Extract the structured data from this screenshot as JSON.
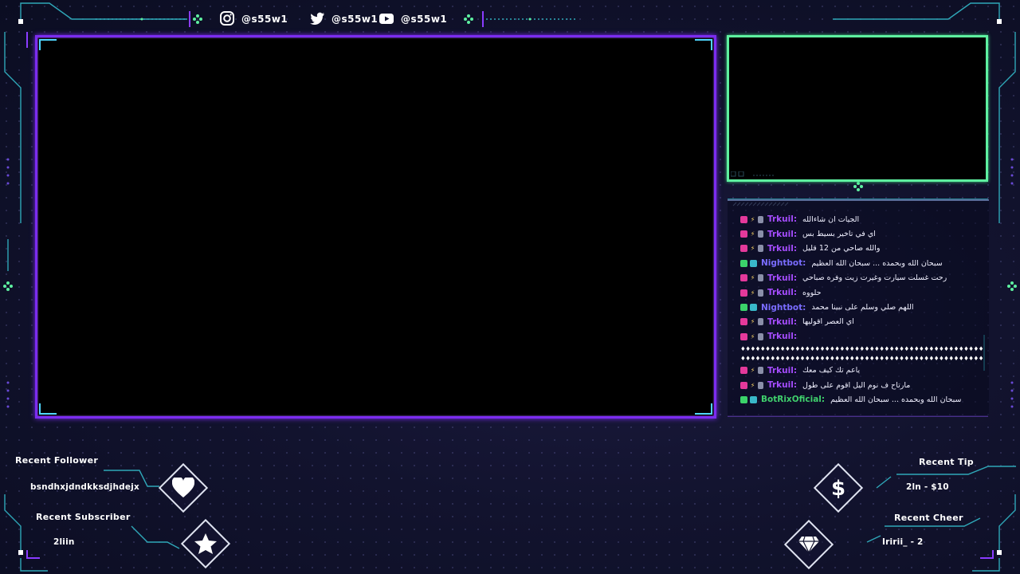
{
  "social": [
    {
      "icon": "instagram-icon",
      "handle": "@s55w1"
    },
    {
      "icon": "twitter-icon",
      "handle": "@s55w1"
    },
    {
      "icon": "youtube-icon",
      "handle": "@s55w1"
    }
  ],
  "chat": {
    "messages": [
      {
        "user": "Trkuil:",
        "user_color": "#a64dff",
        "badge": "pink",
        "text": "الجيات ان شاءالله"
      },
      {
        "user": "Trkuil:",
        "user_color": "#a64dff",
        "badge": "pink",
        "text": "اي في تاخير بسيط بس"
      },
      {
        "user": "Trkuil:",
        "user_color": "#a64dff",
        "badge": "pink",
        "text": "والله صاحي من 12 قليل"
      },
      {
        "user": "Nightbot:",
        "user_color": "#7a6cff",
        "badge": "green",
        "text": "سبحان الله وبحمده ... سبحان الله العظيم"
      },
      {
        "user": "Trkuil:",
        "user_color": "#a64dff",
        "badge": "pink",
        "text": "رحت غسلت سيارت وغيرت زيت وفره صباحي"
      },
      {
        "user": "Trkuil:",
        "user_color": "#a64dff",
        "badge": "pink",
        "text": "حلووه"
      },
      {
        "user": "Nightbot:",
        "user_color": "#7a6cff",
        "badge": "green",
        "text": "اللهم صلي وسلم على نبينا محمد"
      },
      {
        "user": "Trkuil:",
        "user_color": "#a64dff",
        "badge": "pink",
        "text": "اي العصر اقوليها"
      },
      {
        "user": "Trkuil:",
        "user_color": "#a64dff",
        "badge": "pink",
        "text": ""
      }
    ],
    "wrap_lines": [
      "♦♦♦♦♦♦♦♦♦♦♦♦♦♦♦♦♦♦♦♦♦♦♦♦♦♦♦♦♦♦♦♦♦♦♦♦♦♦♦♦♦♦♦♦♦♦♦♦♦♦♦♦♦♦♦♦♦♦♦♦♦♦♦♦♦♦♦♦",
      "♦♦♦♦♦♦♦♦♦♦♦♦♦♦♦♦♦♦♦♦♦♦♦♦♦♦♦♦♦♦♦♦♦♦♦♦♦♦♦♦♦♦♦♦♦♦♦♦♦♦♦♦♦♦♦"
    ],
    "messages_after": [
      {
        "user": "Trkuil:",
        "user_color": "#a64dff",
        "badge": "pink",
        "text": "ياعم تك كيف معك"
      },
      {
        "user": "Trkuil:",
        "user_color": "#a64dff",
        "badge": "pink",
        "text": "مارتاح ف نوم اليل اقوم على طول"
      },
      {
        "user": "BotRixOficial:",
        "user_color": "#3fcf6c",
        "badge": "green",
        "text": "سبحان الله وبحمده ... سبحان الله العظيم"
      }
    ]
  },
  "alerts": {
    "recent_follower_label": "Recent Follower",
    "recent_follower_value": "bsndhxjdndkksdjhdejx",
    "recent_subscriber_label": "Recent Subscriber",
    "recent_subscriber_value": "2liin",
    "recent_tip_label": "Recent Tip",
    "recent_tip_value": "2ln - $10",
    "recent_cheer_label": "Recent Cheer",
    "recent_cheer_value": "Iririi_ - 2"
  },
  "colors": {
    "game_frame": "#7b2cf0",
    "cam_frame": "#5ef0a0",
    "accent_teal": "#3fb8c9",
    "accent_purple": "#8a3cff"
  }
}
